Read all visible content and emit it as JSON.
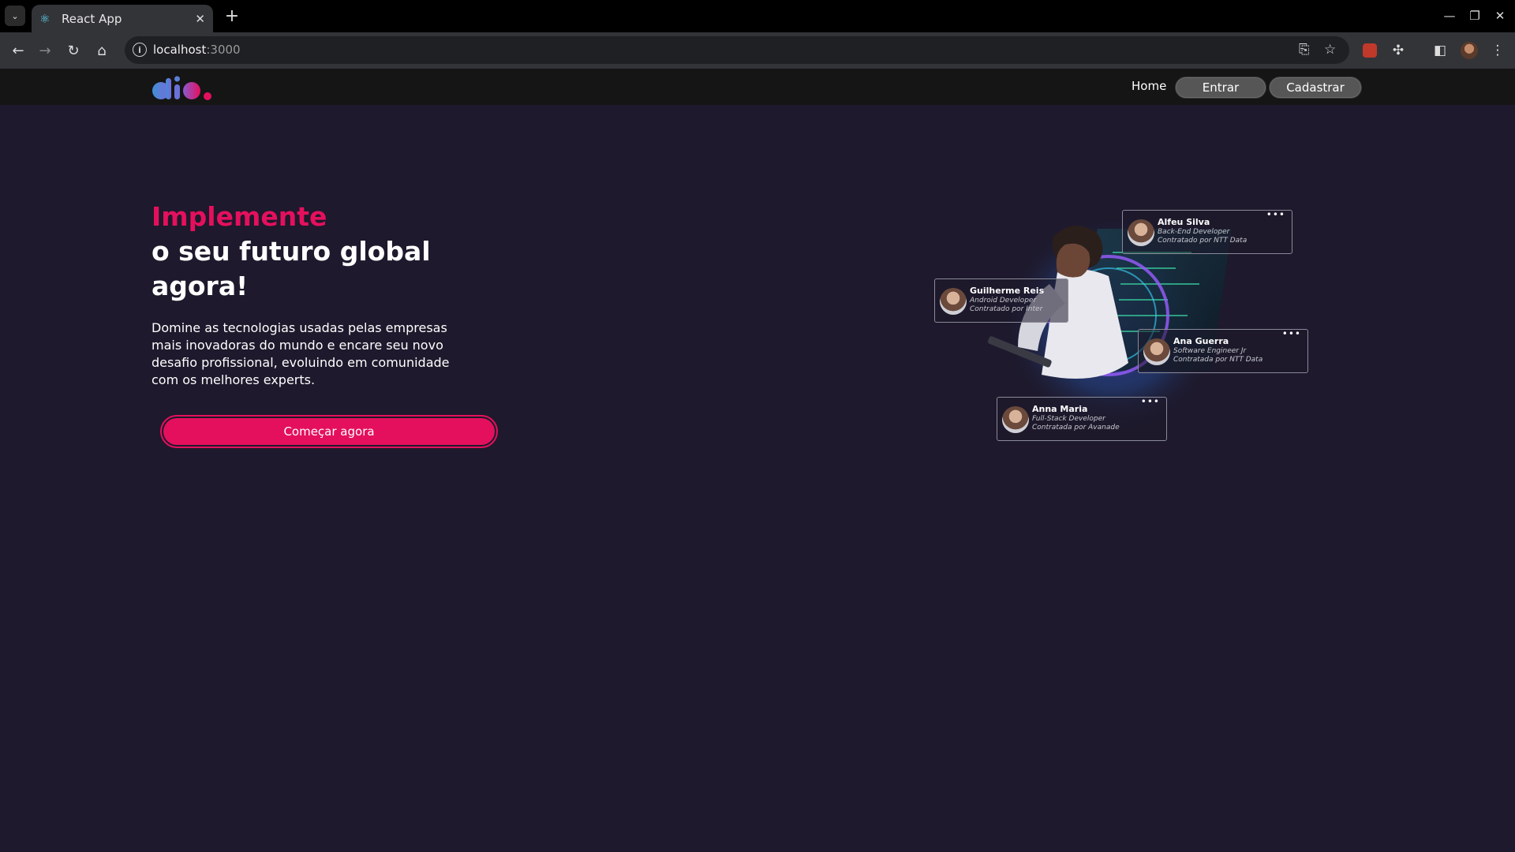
{
  "browser": {
    "tab_title": "React App",
    "url_host": "localhost",
    "url_port": ":3000"
  },
  "header": {
    "nav_home": "Home",
    "login_label": "Entrar",
    "signup_label": "Cadastrar"
  },
  "hero": {
    "title_accent": "Implemente",
    "title_line1": "o seu futuro global",
    "title_line2": "agora!",
    "description": "Domine as tecnologias usadas pelas empresas mais inovadoras do mundo e encare seu novo desafio profissional, evoluindo em comunidade com os melhores experts.",
    "cta_label": "Começar agora"
  },
  "profiles": [
    {
      "name": "Alfeu Silva",
      "role": "Back-End Developer",
      "company": "Contratado por NTT Data"
    },
    {
      "name": "Guilherme Reis",
      "role": "Android Developer",
      "company": "Contratado por Inter"
    },
    {
      "name": "Ana Guerra",
      "role": "Software Engineer Jr",
      "company": "Contratada por NTT Data"
    },
    {
      "name": "Anna Maria",
      "role": "Full-Stack Developer",
      "company": "Contratada por Avanade"
    }
  ],
  "colors": {
    "accent": "#e4105d",
    "background": "#1e192c",
    "header_bg": "#151515"
  }
}
